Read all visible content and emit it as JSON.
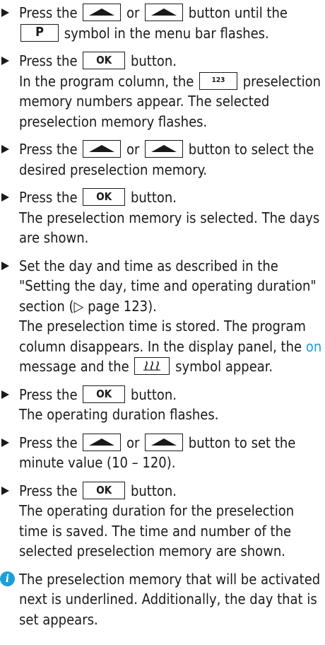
{
  "steps": [
    {
      "parts": [
        "Press the ",
        " or ",
        " button until the ",
        " symbol in the menu bar flashes."
      ],
      "keys": [
        "left-arrow",
        "right-arrow",
        "P"
      ]
    },
    {
      "parts": [
        "Press the ",
        " button."
      ],
      "keys": [
        "OK"
      ],
      "result": [
        "In the program column, the ",
        " preselection memory numbers appear. The selected preselection memory flashes."
      ],
      "result_keys": [
        "123"
      ]
    },
    {
      "parts": [
        "Press the ",
        " or ",
        " button to select the desired preselection memory."
      ],
      "keys": [
        "left-arrow",
        "right-arrow"
      ]
    },
    {
      "parts": [
        "Press the ",
        " button."
      ],
      "keys": [
        "OK"
      ],
      "result": [
        "The preselection memory is selected. The days are shown."
      ]
    },
    {
      "parts": [
        "Set the day and time as described in the \"Setting the day, time and operating duration\" section (▷ page 123)."
      ],
      "keys": [],
      "result": [
        "The preselection time is stored. The program column disappears. In the display panel, the ",
        " message and the ",
        " symbol appear."
      ],
      "result_keys": [
        "on-text",
        "heater"
      ]
    },
    {
      "parts": [
        "Press the ",
        " button."
      ],
      "keys": [
        "OK"
      ],
      "result": [
        "The operating duration flashes."
      ]
    },
    {
      "parts": [
        "Press the ",
        " or ",
        " button to set the minute value (10 – 120)."
      ],
      "keys": [
        "left-arrow",
        "right-arrow"
      ]
    },
    {
      "parts": [
        "Press the ",
        " button."
      ],
      "keys": [
        "OK"
      ],
      "result": [
        "The operating duration for the preselection time is saved. The time and number of the selected preselection memory are shown."
      ]
    }
  ],
  "key_labels": {
    "OK": "OK",
    "P": "P",
    "123": "123",
    "heater": "⸾⸾⸾",
    "on": "on"
  },
  "note": "The preselection memory that will be activated next is underlined. Additionally, the day that is set appears.",
  "colors": {
    "accent": "#1b9fd5",
    "text": "#1a1a1a"
  }
}
